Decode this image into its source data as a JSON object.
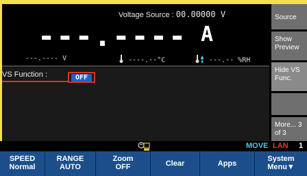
{
  "measurement": {
    "voltage_source_label": "Voltage Source :",
    "voltage_source_value": "00.00000 V",
    "main_reading": "---.----",
    "main_unit": "A",
    "voltage_reading": "---.---- V",
    "temperature_reading": "----.--°C",
    "humidity_reading": "---.-- %RH"
  },
  "function_panel": {
    "label": "VS Function :",
    "value": "OFF"
  },
  "softkeys": [
    {
      "label": "Source"
    },
    {
      "label": "Show Preview"
    },
    {
      "label": "Hide VS Func."
    },
    {
      "label": ""
    },
    {
      "label": "More... 3 of 3"
    }
  ],
  "status_bar": {
    "mode": "MOVE",
    "interface": "LAN",
    "channel": "1"
  },
  "function_keys": [
    {
      "line1": "SPEED",
      "line2": "Normal"
    },
    {
      "line1": "RANGE",
      "line2": "AUTO"
    },
    {
      "line1": "Zoom",
      "line2": "OFF"
    },
    {
      "line1": "Clear",
      "line2": ""
    },
    {
      "line1": "Apps",
      "line2": ""
    },
    {
      "line1": "System",
      "line2": "Menu▼"
    }
  ],
  "icons": [
    "thermometer-icon",
    "humidity-icon",
    "usb-drive-icon"
  ],
  "colors": {
    "frame": "#f3e04a",
    "highlight": "#e0302a",
    "value_bg": "#1f63c6",
    "key_bg": "#1c4e8c",
    "softkey_bg": "#6f6f6f",
    "move_text": "#3ad1e8",
    "lan_text": "#e03a3a"
  }
}
